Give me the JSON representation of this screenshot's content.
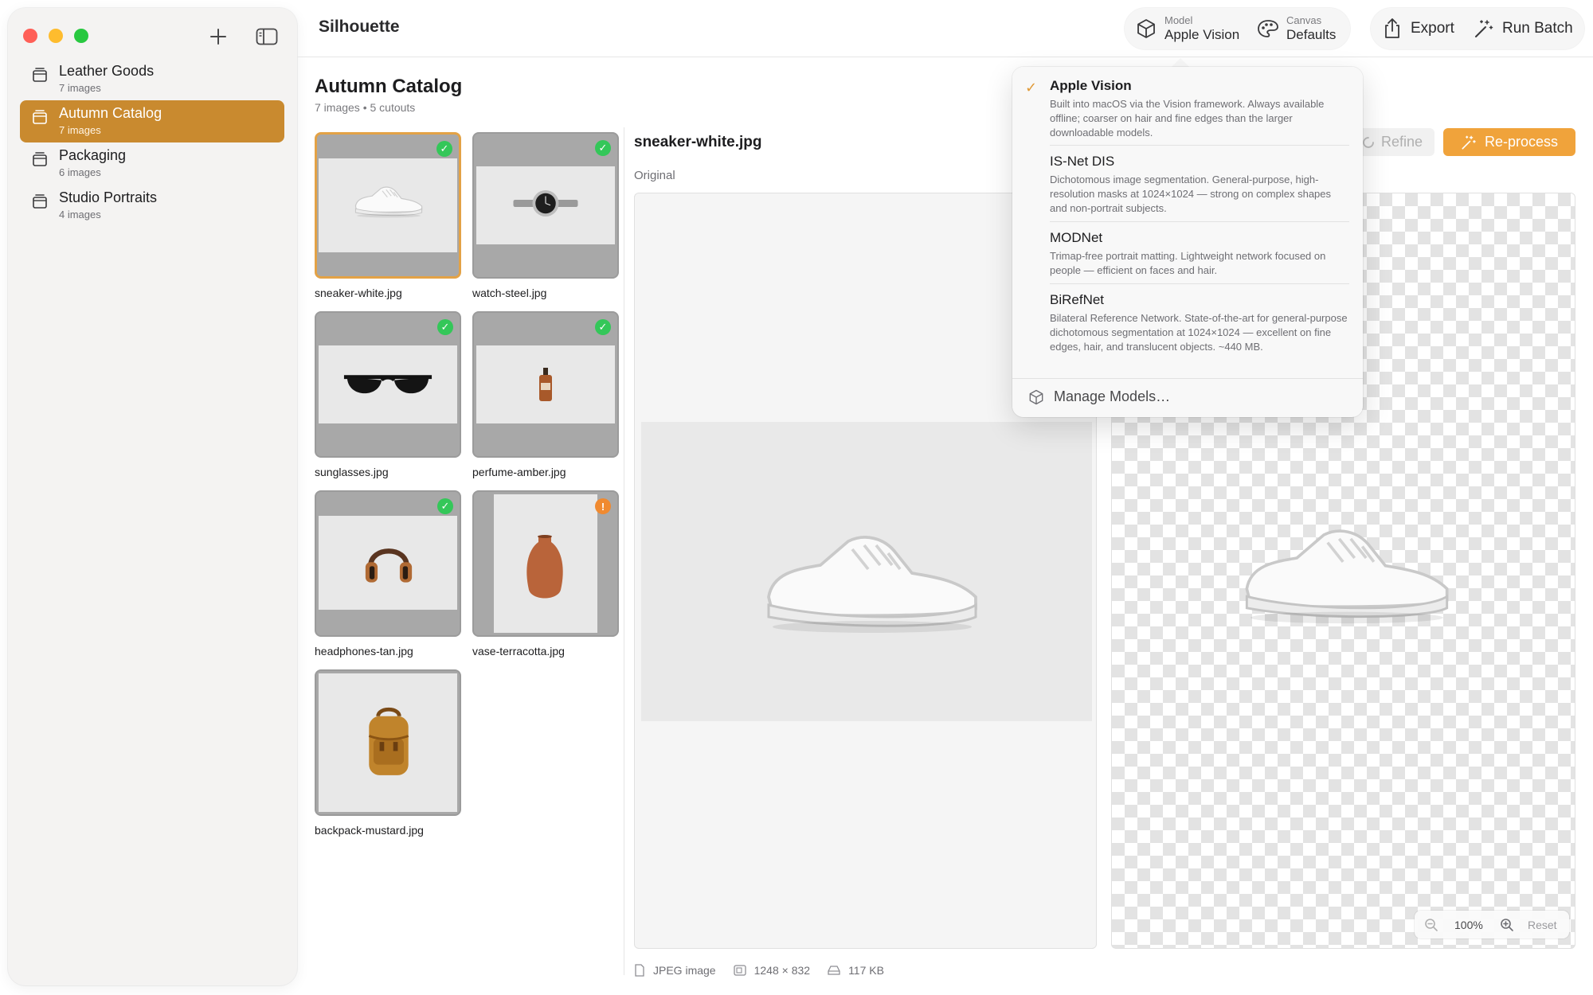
{
  "app": {
    "title": "Silhouette"
  },
  "sidebar": {
    "catalogs": [
      {
        "name": "Leather Goods",
        "count": "7 images",
        "active": false
      },
      {
        "name": "Autumn Catalog",
        "count": "7 images",
        "active": true
      },
      {
        "name": "Packaging",
        "count": "6 images",
        "active": false
      },
      {
        "name": "Studio Portraits",
        "count": "4 images",
        "active": false
      }
    ]
  },
  "toolbar": {
    "model_caption": "Model",
    "model_value": "Apple Vision",
    "canvas_caption": "Canvas",
    "canvas_value": "Defaults",
    "export_label": "Export",
    "run_batch_label": "Run Batch"
  },
  "header": {
    "title": "Autumn Catalog",
    "subtitle": "7 images • 5 cutouts"
  },
  "grid": {
    "items": [
      {
        "filename": "sneaker-white.jpg",
        "status": "done",
        "selected": true,
        "object": "sneaker"
      },
      {
        "filename": "watch-steel.jpg",
        "status": "done",
        "selected": false,
        "object": "watch"
      },
      {
        "filename": "sunglasses.jpg",
        "status": "done",
        "selected": false,
        "object": "sunglasses"
      },
      {
        "filename": "perfume-amber.jpg",
        "status": "done",
        "selected": false,
        "object": "perfume"
      },
      {
        "filename": "headphones-tan.jpg",
        "status": "done",
        "selected": false,
        "object": "headphones"
      },
      {
        "filename": "vase-terracotta.jpg",
        "status": "warning",
        "selected": false,
        "object": "vase"
      },
      {
        "filename": "backpack-mustard.jpg",
        "status": "none",
        "selected": false,
        "object": "backpack"
      }
    ],
    "badge_ok_glyph": "✓",
    "badge_warn_glyph": "!"
  },
  "detail": {
    "filename": "sneaker-white.jpg",
    "original_label": "Original",
    "refine_label": "Refine",
    "reprocess_label": "Re-process",
    "zoom_value": "100%",
    "reset_label": "Reset",
    "info": {
      "type": "JPEG image",
      "dimensions": "1248 × 832",
      "size": "117 KB"
    }
  },
  "model_menu": {
    "items": [
      {
        "name": "Apple Vision",
        "checked": true,
        "description": "Built into macOS via the Vision framework. Always available offline; coarser on hair and fine edges than the larger downloadable models."
      },
      {
        "name": "IS-Net DIS",
        "checked": false,
        "description": "Dichotomous image segmentation. General-purpose, high-resolution masks at 1024×1024 — strong on complex shapes and non-portrait subjects."
      },
      {
        "name": "MODNet",
        "checked": false,
        "description": "Trimap-free portrait matting. Lightweight network focused on people — efficient on faces and hair."
      },
      {
        "name": "BiRefNet",
        "checked": false,
        "description": "Bilateral Reference Network. State-of-the-art for general-purpose dichotomous segmentation at 1024×1024 — excellent on fine edges, hair, and translucent objects. ~440 MB."
      }
    ],
    "manage_label": "Manage Models…",
    "check_glyph": "✓"
  },
  "colors": {
    "accent": "#f0a33b",
    "sidebar_selection": "#c98a2f",
    "success": "#34c759",
    "warning": "#f08a30"
  }
}
